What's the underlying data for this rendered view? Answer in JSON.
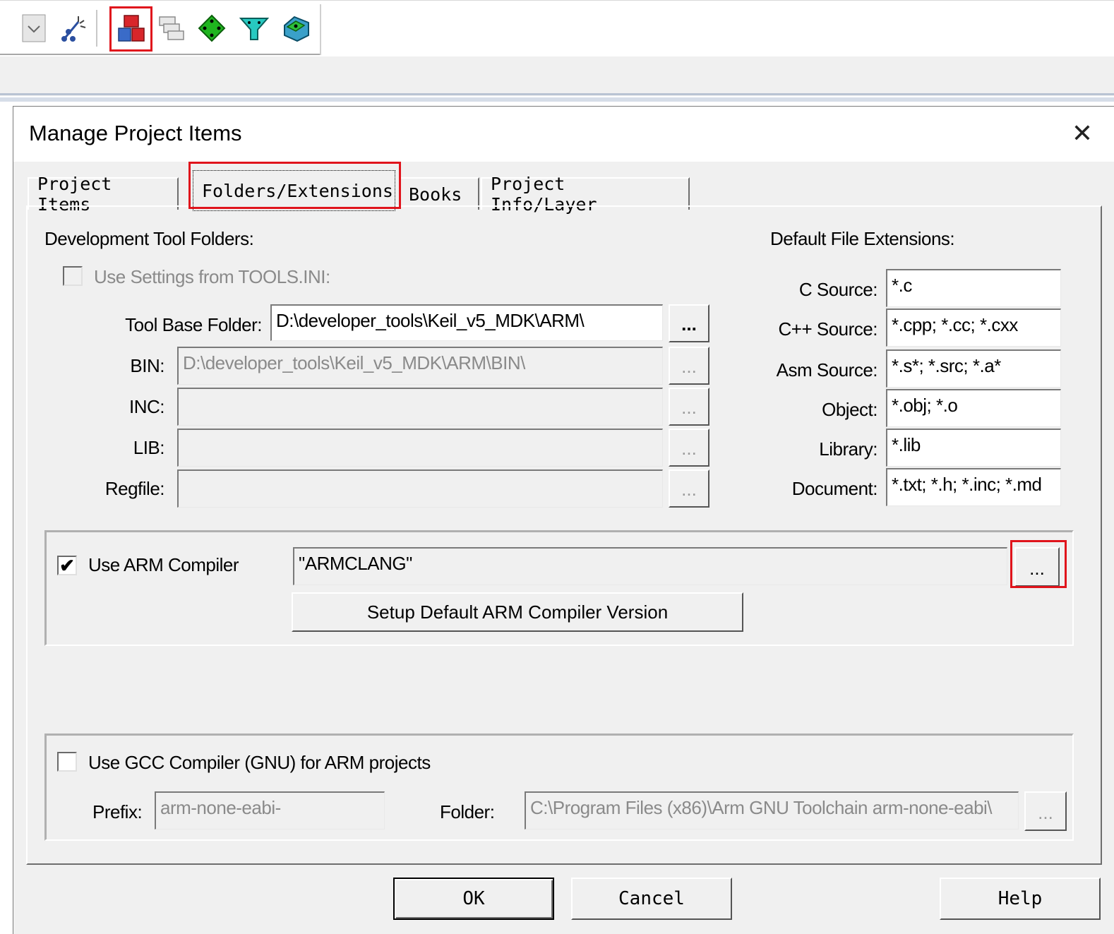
{
  "toolbar": {
    "icons": [
      "dropdown-arrow-icon",
      "magic-wand-icon",
      "manage-project-items-icon",
      "batch-build-icon",
      "target-options-icon",
      "filter-funnel-icon",
      "pack-installer-icon"
    ]
  },
  "dialog": {
    "title": "Manage Project Items",
    "close_glyph": "✕",
    "tabs": [
      "Project Items",
      "Folders/Extensions",
      "Books",
      "Project Info/Layer"
    ],
    "active_tab": "Folders/Extensions"
  },
  "folders": {
    "heading": "Development Tool Folders:",
    "use_tools_ini_label": "Use Settings from TOOLS.INI:",
    "use_tools_ini_checked": false,
    "tool_base_label": "Tool Base Folder:",
    "tool_base_value": "D:\\developer_tools\\Keil_v5_MDK\\ARM\\",
    "bin_label": "BIN:",
    "bin_value": "D:\\developer_tools\\Keil_v5_MDK\\ARM\\BIN\\",
    "inc_label": "INC:",
    "inc_value": "",
    "lib_label": "LIB:",
    "lib_value": "",
    "regfile_label": "Regfile:",
    "regfile_value": "",
    "browse_label": "..."
  },
  "extensions": {
    "heading": "Default File Extensions:",
    "rows": [
      {
        "label": "C Source:",
        "value": "*.c"
      },
      {
        "label": "C++ Source:",
        "value": "*.cpp; *.cc; *.cxx"
      },
      {
        "label": "Asm Source:",
        "value": "*.s*; *.src; *.a*"
      },
      {
        "label": "Object:",
        "value": "*.obj; *.o"
      },
      {
        "label": "Library:",
        "value": "*.lib"
      },
      {
        "label": "Document:",
        "value": "*.txt; *.h; *.inc; *.md"
      }
    ]
  },
  "arm_compiler": {
    "checkbox_label": "Use ARM Compiler",
    "checked": true,
    "check_glyph": "✔",
    "value": "\"ARMCLANG\"",
    "browse_label": "...",
    "setup_button": "Setup Default ARM Compiler Version"
  },
  "gcc": {
    "checkbox_label": "Use GCC Compiler (GNU) for ARM projects",
    "checked": false,
    "prefix_label": "Prefix:",
    "prefix_value": "arm-none-eabi-",
    "folder_label": "Folder:",
    "folder_value": "C:\\Program Files (x86)\\Arm GNU Toolchain arm-none-eabi\\",
    "browse_label": "..."
  },
  "buttons": {
    "ok": "OK",
    "cancel": "Cancel",
    "help": "Help"
  },
  "colors": {
    "highlight": "#e0141c",
    "dialog_bg": "#f0f0f0"
  }
}
